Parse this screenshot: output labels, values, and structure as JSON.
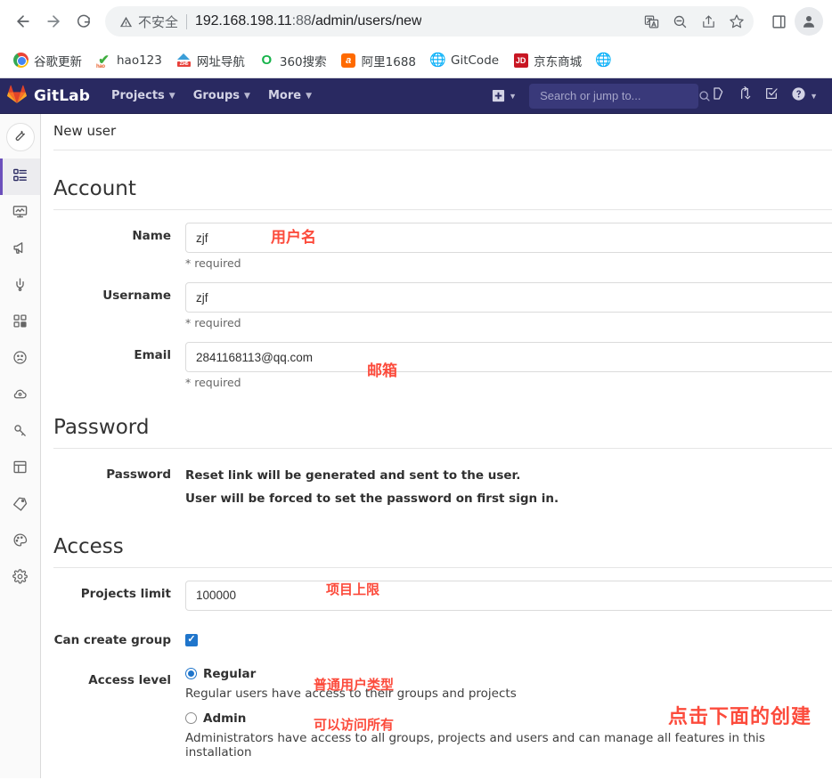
{
  "browser": {
    "nav": {
      "back_label": "Back",
      "forward_label": "Forward",
      "reload_label": "Reload"
    },
    "omnibox": {
      "security_text": "不安全",
      "url_host": "192.168.198.11",
      "url_port": ":88",
      "url_path": "/admin/users/new",
      "url_full": "192.168.198.11:88/admin/users/new",
      "icons": [
        "translate-icon",
        "zoom-out-icon",
        "share-icon",
        "bookmark-star-icon"
      ]
    },
    "toolbar_right": {
      "side_panel_label": "Side panel",
      "profile_label": "Profile"
    },
    "bookmarks": [
      {
        "label": "谷歌更新",
        "icon": "chrome-icon"
      },
      {
        "label": "hao123",
        "icon": "hao123-icon"
      },
      {
        "label": "网址导航",
        "icon": "2345-icon"
      },
      {
        "label": "360搜索",
        "icon": "360-icon"
      },
      {
        "label": "阿里1688",
        "icon": "alibaba-icon"
      },
      {
        "label": "GitCode",
        "icon": "globe-icon"
      },
      {
        "label": "京东商城",
        "icon": "jd-icon"
      },
      {
        "label": "",
        "icon": "globe-icon"
      }
    ]
  },
  "gitlab_navbar": {
    "brand": "GitLab",
    "items": [
      {
        "label": "Projects"
      },
      {
        "label": "Groups"
      },
      {
        "label": "More"
      }
    ],
    "plus_label": "Create new",
    "search_placeholder": "Search or jump to...",
    "search_value": "",
    "right_icons": [
      "issues-icon",
      "merge-requests-icon",
      "todos-icon",
      "help-icon"
    ]
  },
  "sidebar": {
    "avatar_icon": "wrench-icon",
    "items": [
      {
        "icon": "overview-icon",
        "active": true
      },
      {
        "icon": "monitoring-icon",
        "active": false
      },
      {
        "icon": "messages-icon",
        "active": false
      },
      {
        "icon": "system-hooks-icon",
        "active": false
      },
      {
        "icon": "applications-icon",
        "active": false
      },
      {
        "icon": "abuse-reports-icon",
        "active": false
      },
      {
        "icon": "kubernetes-icon",
        "active": false
      },
      {
        "icon": "deploy-keys-icon",
        "active": false
      },
      {
        "icon": "labels-page-icon",
        "active": false
      },
      {
        "icon": "labels-icon",
        "active": false
      },
      {
        "icon": "appearance-icon",
        "active": false
      },
      {
        "icon": "settings-gear-icon",
        "active": false
      }
    ]
  },
  "page": {
    "title": "New user",
    "sections": {
      "account": {
        "heading": "Account",
        "name": {
          "label": "Name",
          "value": "zjf",
          "placeholder": "",
          "help": "* required"
        },
        "username": {
          "label": "Username",
          "value": "zjf",
          "placeholder": "",
          "help": "* required"
        },
        "email": {
          "label": "Email",
          "value": "2841168113@qq.com",
          "placeholder": "",
          "help": "* required"
        }
      },
      "password": {
        "heading": "Password",
        "label": "Password",
        "line1": "Reset link will be generated and sent to the user.",
        "line2": "User will be forced to set the password on first sign in."
      },
      "access": {
        "heading": "Access",
        "projects_limit": {
          "label": "Projects limit",
          "value": "100000",
          "placeholder": ""
        },
        "can_create_group": {
          "label": "Can create group",
          "checked": true
        },
        "access_level": {
          "label": "Access level",
          "options": [
            {
              "label": "Regular",
              "description": "Regular users have access to their groups and projects",
              "selected": true
            },
            {
              "label": "Admin",
              "description": "Administrators have access to all groups, projects and users and can manage all features in this installation",
              "selected": false
            }
          ]
        }
      }
    }
  },
  "annotations": {
    "color": "#fc4b3c",
    "username": "用户名",
    "email": "邮箱",
    "projects_limit": "项目上限",
    "regular_type": "普通用户类型",
    "access_all": "可以访问所有",
    "click_create": "点击下面的创建"
  }
}
